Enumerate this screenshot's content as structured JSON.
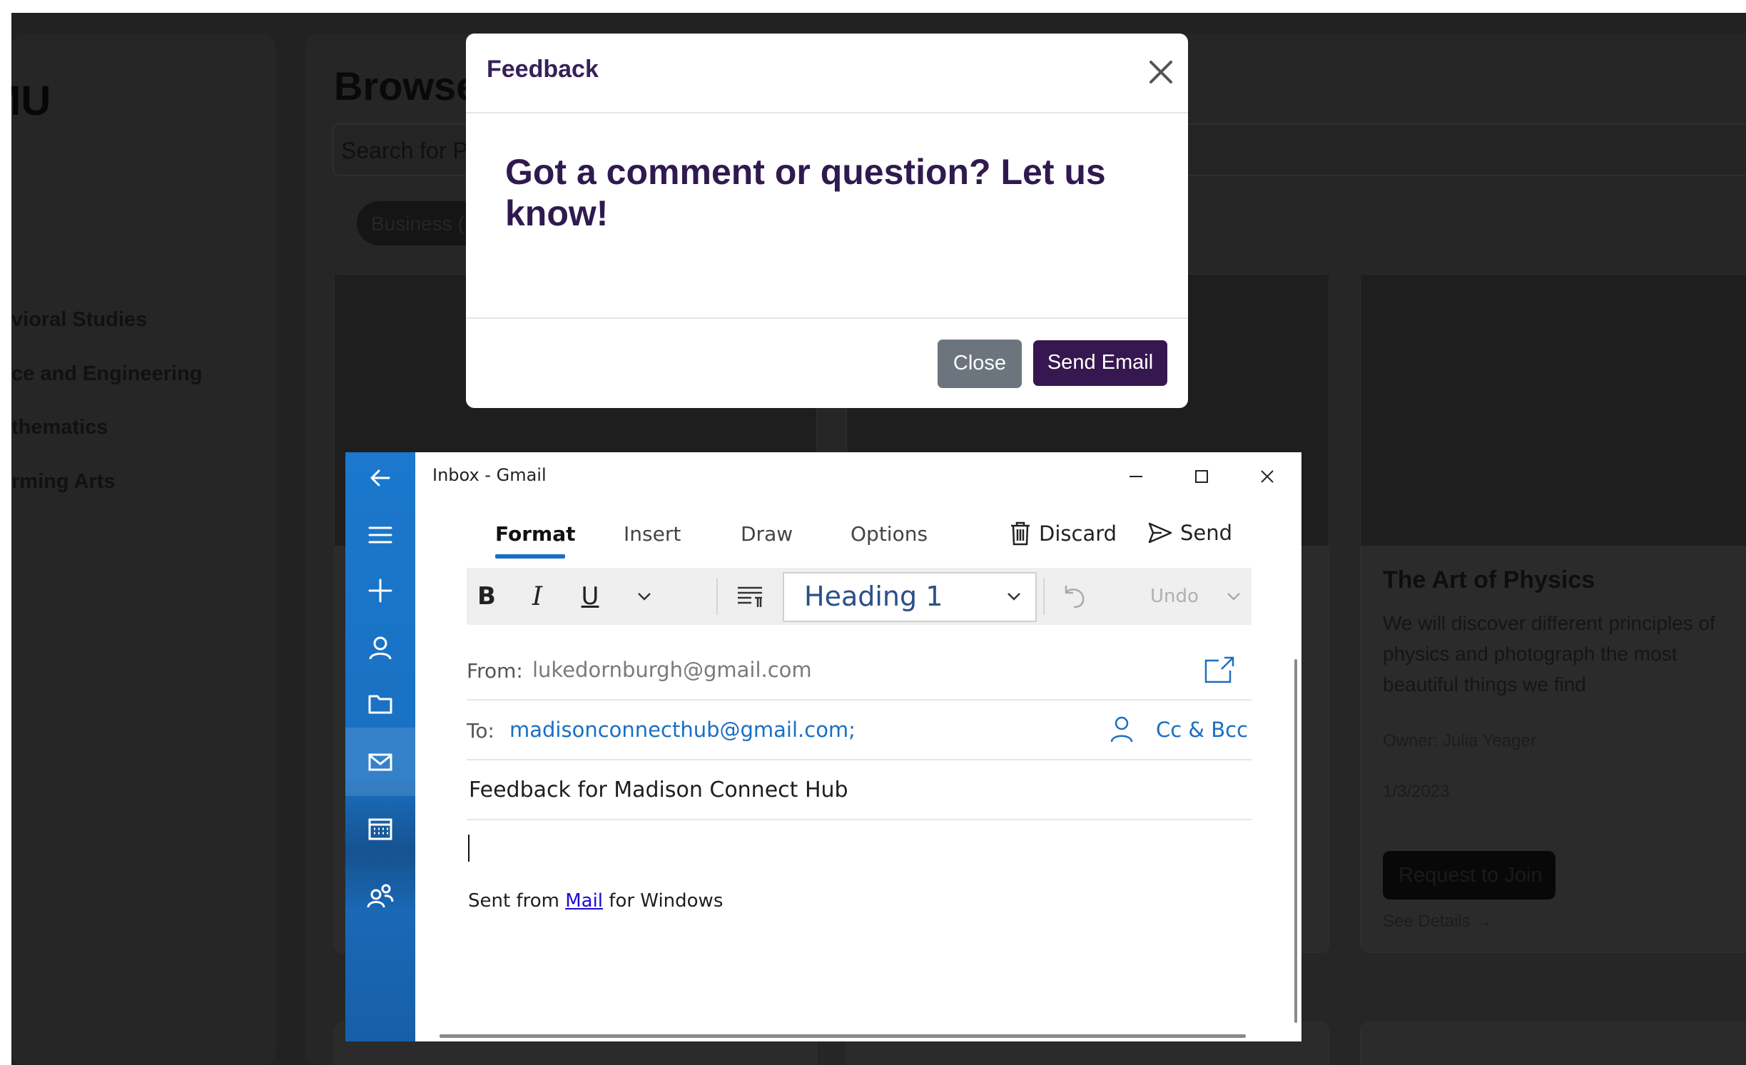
{
  "background": {
    "brand": "MU",
    "categories": [
      "vioral Studies",
      "ce and Engineering",
      "thematics",
      "rming Arts"
    ],
    "browse_title": "Browse",
    "search_placeholder": "Search for P",
    "chip_label": "Business (",
    "card": {
      "title": "The Art of Physics",
      "description": "We will discover different principles of physics and photograph the most beautiful things we find",
      "owner": "Owner: Julia Yeager",
      "date": "1/3/2023",
      "join_label": "Request to Join",
      "details_label": "See Details →"
    }
  },
  "modal": {
    "title": "Feedback",
    "body": "Got a comment or question? Let us know!",
    "close_label": "Close",
    "send_label": "Send Email"
  },
  "mail": {
    "window_title": "Inbox - Gmail",
    "tabs": [
      "Format",
      "Insert",
      "Draw",
      "Options"
    ],
    "discard_label": "Discard",
    "send_label": "Send",
    "toolbar": {
      "bold": "B",
      "italic": "I",
      "underline": "U",
      "style": "Heading 1",
      "undo_label": "Undo"
    },
    "from_label": "From:",
    "from_value": "lukedornburgh@gmail.com",
    "to_label": "To:",
    "to_value": "madisonconnecthub@gmail.com;",
    "cc_bcc_label": "Cc & Bcc",
    "subject": "Feedback for Madison Connect Hub",
    "signature": {
      "prefix": "Sent from",
      "link": "Mail",
      "suffix": "for Windows"
    },
    "accent_color": "#1a6fc4"
  }
}
